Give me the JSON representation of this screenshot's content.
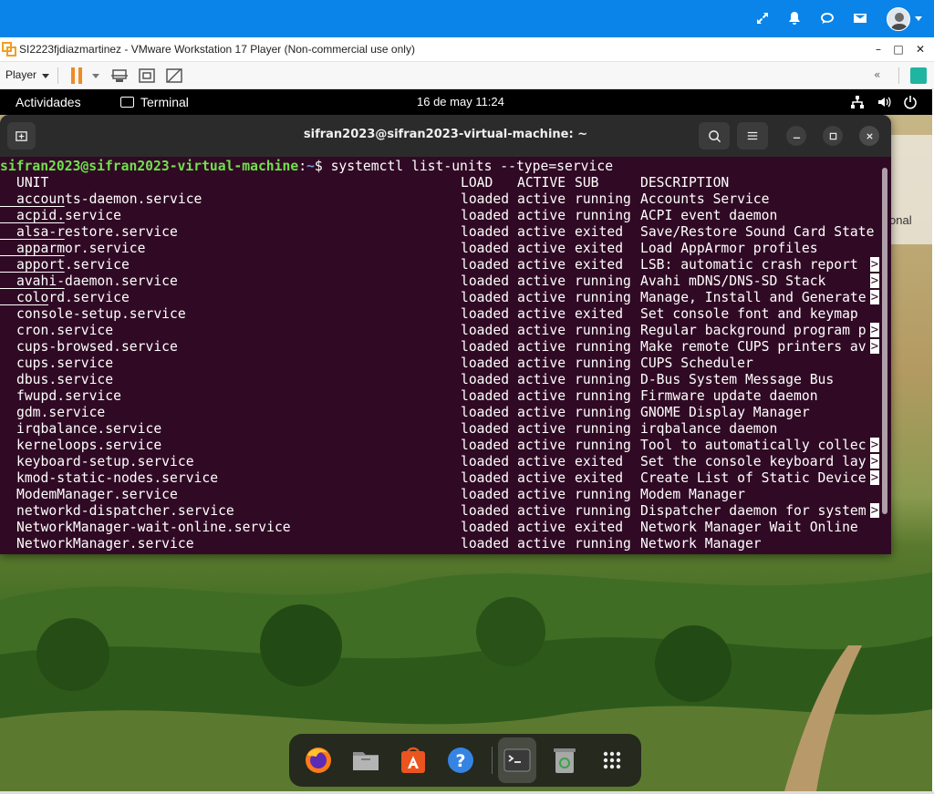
{
  "host": {
    "icons": [
      "expand-icon",
      "bell-icon",
      "chat-icon",
      "mail-icon",
      "avatar"
    ]
  },
  "vmware": {
    "title": "SI2223fjdiazmartinez - VMware Workstation 17 Player (Non-commercial use only)",
    "player_menu": "Player",
    "window_controls": {
      "minimize": "–",
      "maximize": "□",
      "close": "✕"
    },
    "collapse": "«"
  },
  "gnome": {
    "activities": "Actividades",
    "app_name": "Terminal",
    "clock": "16 de may  11:24"
  },
  "peek_text": "onal",
  "terminal": {
    "title": "sifran2023@sifran2023-virtual-machine: ~",
    "prompt_user": "sifran2023@sifran2023-virtual-machine",
    "prompt_sep": ":",
    "prompt_path": "~",
    "prompt_dollar": "$ ",
    "command": "systemctl list-units --type=service",
    "headers": {
      "unit": "UNIT",
      "load": "LOAD",
      "active": "ACTIVE",
      "sub": "SUB",
      "description": "DESCRIPTION"
    },
    "rows": [
      {
        "unit": "accounts-daemon.service",
        "load": "loaded",
        "active": "active",
        "sub": "running",
        "description": "Accounts Service",
        "truncated": false
      },
      {
        "unit": "acpid.service",
        "load": "loaded",
        "active": "active",
        "sub": "running",
        "description": "ACPI event daemon",
        "truncated": false
      },
      {
        "unit": "alsa-restore.service",
        "load": "loaded",
        "active": "active",
        "sub": "exited",
        "description": "Save/Restore Sound Card State",
        "truncated": false
      },
      {
        "unit": "apparmor.service",
        "load": "loaded",
        "active": "active",
        "sub": "exited",
        "description": "Load AppArmor profiles",
        "truncated": false
      },
      {
        "unit": "apport.service",
        "load": "loaded",
        "active": "active",
        "sub": "exited",
        "description": "LSB: automatic crash report",
        "truncated": true
      },
      {
        "unit": "avahi-daemon.service",
        "load": "loaded",
        "active": "active",
        "sub": "running",
        "description": "Avahi mDNS/DNS-SD Stack",
        "truncated": false
      },
      {
        "unit": "colord.service",
        "load": "loaded",
        "active": "active",
        "sub": "running",
        "description": "Manage, Install and Generate",
        "truncated": true
      },
      {
        "unit": "console-setup.service",
        "load": "loaded",
        "active": "active",
        "sub": "exited",
        "description": "Set console font and keymap",
        "truncated": false
      },
      {
        "unit": "cron.service",
        "load": "loaded",
        "active": "active",
        "sub": "running",
        "description": "Regular background program p",
        "truncated": true
      },
      {
        "unit": "cups-browsed.service",
        "load": "loaded",
        "active": "active",
        "sub": "running",
        "description": "Make remote CUPS printers av",
        "truncated": true
      },
      {
        "unit": "cups.service",
        "load": "loaded",
        "active": "active",
        "sub": "running",
        "description": "CUPS Scheduler",
        "truncated": false
      },
      {
        "unit": "dbus.service",
        "load": "loaded",
        "active": "active",
        "sub": "running",
        "description": "D-Bus System Message Bus",
        "truncated": false
      },
      {
        "unit": "fwupd.service",
        "load": "loaded",
        "active": "active",
        "sub": "running",
        "description": "Firmware update daemon",
        "truncated": false
      },
      {
        "unit": "gdm.service",
        "load": "loaded",
        "active": "active",
        "sub": "running",
        "description": "GNOME Display Manager",
        "truncated": false
      },
      {
        "unit": "irqbalance.service",
        "load": "loaded",
        "active": "active",
        "sub": "running",
        "description": "irqbalance daemon",
        "truncated": false
      },
      {
        "unit": "kerneloops.service",
        "load": "loaded",
        "active": "active",
        "sub": "running",
        "description": "Tool to automatically collec",
        "truncated": true
      },
      {
        "unit": "keyboard-setup.service",
        "load": "loaded",
        "active": "active",
        "sub": "exited",
        "description": "Set the console keyboard lay",
        "truncated": true
      },
      {
        "unit": "kmod-static-nodes.service",
        "load": "loaded",
        "active": "active",
        "sub": "exited",
        "description": "Create List of Static Device",
        "truncated": true
      },
      {
        "unit": "ModemManager.service",
        "load": "loaded",
        "active": "active",
        "sub": "running",
        "description": "Modem Manager",
        "truncated": false
      },
      {
        "unit": "networkd-dispatcher.service",
        "load": "loaded",
        "active": "active",
        "sub": "running",
        "description": "Dispatcher daemon for system",
        "truncated": true
      },
      {
        "unit": "NetworkManager-wait-online.service",
        "load": "loaded",
        "active": "active",
        "sub": "exited",
        "description": "Network Manager Wait Online",
        "truncated": false
      },
      {
        "unit": "NetworkManager.service",
        "load": "loaded",
        "active": "active",
        "sub": "running",
        "description": "Network Manager",
        "truncated": false
      }
    ],
    "trunc_marker": ">"
  },
  "dock": {
    "items": [
      "firefox-icon",
      "files-icon",
      "app-center-icon",
      "help-icon",
      "terminal-icon",
      "trash-icon",
      "show-apps-icon"
    ]
  },
  "colors": {
    "host_bar": "#0a84e8",
    "terminal_bg": "#300a24",
    "prompt_user": "#6ee24b",
    "prompt_path": "#6f9bd8",
    "pause_accent": "#f08a24"
  }
}
